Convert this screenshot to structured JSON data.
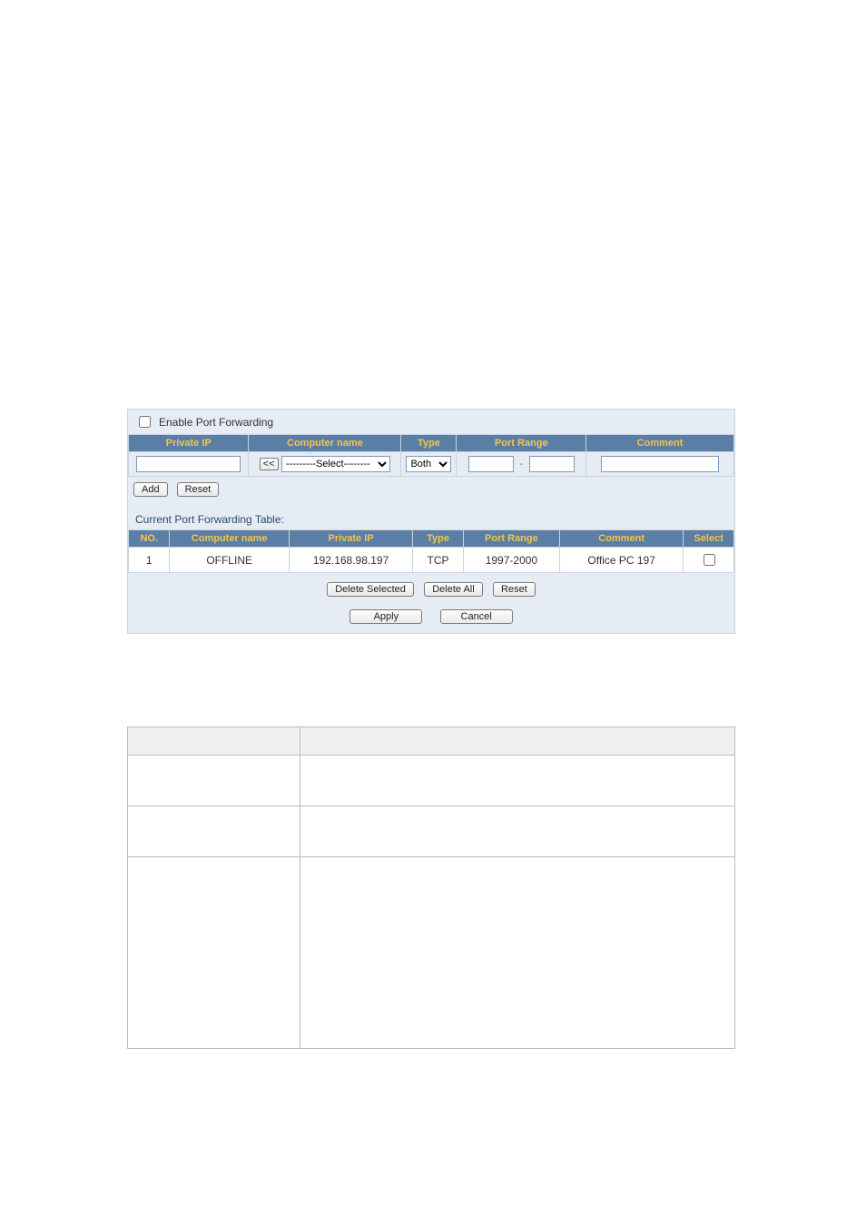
{
  "enable_label": "Enable Port Forwarding",
  "input_headers": {
    "private_ip": "Private IP",
    "computer_name": "Computer name",
    "type": "Type",
    "port_range": "Port Range",
    "comment": "Comment"
  },
  "input_row": {
    "private_ip": "",
    "copy_btn": "<<",
    "computer_select_placeholder": "---------Select--------",
    "type_select_value": "Both",
    "port_from": "",
    "port_to": "",
    "comment": ""
  },
  "buttons": {
    "add": "Add",
    "reset": "Reset",
    "delete_selected": "Delete Selected",
    "delete_all": "Delete All",
    "apply": "Apply",
    "cancel": "Cancel"
  },
  "current_table_label": "Current Port Forwarding Table:",
  "table_headers": {
    "no": "NO.",
    "computer_name": "Computer name",
    "private_ip": "Private IP",
    "type": "Type",
    "port_range": "Port Range",
    "comment": "Comment",
    "select": "Select"
  },
  "rows": [
    {
      "no": "1",
      "computer_name": "OFFLINE",
      "private_ip": "192.168.98.197",
      "type": "TCP",
      "port_range": "1997-2000",
      "comment": "Office PC 197"
    }
  ],
  "desc_table_headers": {
    "parameter": "",
    "description": ""
  },
  "desc_rows_heights": [
    30,
    55,
    55,
    210
  ]
}
